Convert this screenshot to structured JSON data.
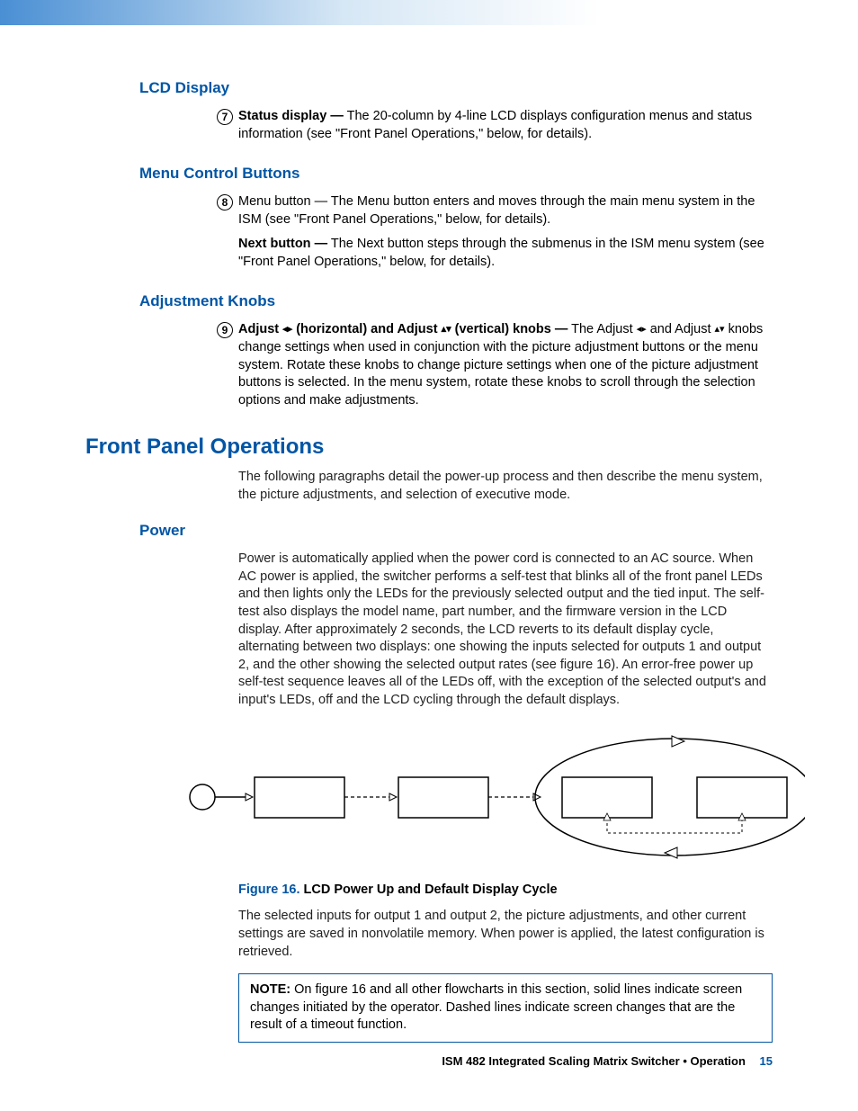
{
  "sections": {
    "lcd": {
      "heading": "LCD Display",
      "item_num": "7",
      "item_lead": "Status display —",
      "item_text": " The 20-column by 4-line LCD displays configuration menus and status information (see \"Front Panel Operations,\" below, for details)."
    },
    "menu": {
      "heading": "Menu Control Buttons",
      "item_num": "8",
      "menu_text": "Menu button — The Menu button enters and moves through the main menu system in the ISM (see \"Front Panel Operations,\" below, for details).",
      "next_lead": "Next button —",
      "next_text": " The Next button steps through the submenus in the ISM menu system (see \"Front Panel Operations,\" below, for details)."
    },
    "adjust": {
      "heading": "Adjustment Knobs",
      "item_num": "9",
      "lead1": "Adjust ",
      "lead2": " (horizontal) and Adjust ",
      "lead3": " (vertical) knobs —",
      "tail1": " The Adjust ",
      "tail2": " and Adjust ",
      "tail3": " knobs change settings when used in conjunction with the picture adjustment buttons or the menu system.  Rotate these knobs to change picture settings when one of the picture adjustment buttons is selected.  In the menu system, rotate these knobs to scroll through the selection options and make adjustments."
    },
    "front_panel": {
      "heading": "Front Panel Operations",
      "intro": "The following paragraphs detail the power-up process and then describe the menu system, the picture adjustments, and selection of executive mode."
    },
    "power": {
      "heading": "Power",
      "p1": "Power is automatically applied when the power cord is connected to an AC source.  When AC power is applied, the switcher performs a self-test that blinks all of the front panel LEDs and then lights only the LEDs for the previously selected output and the tied input.  The self-test also displays the model name, part number, and the firmware version in the LCD display.  After approximately 2 seconds, the LCD reverts to its default display cycle, alternating between two displays: one showing the inputs selected for outputs 1 and output 2, and the other showing the selected output rates (see figure 16).  An error-free power up self-test sequence leaves all of the LEDs off, with the exception of the selected output's and input's LEDs, off and the LCD cycling through the default displays.",
      "fig_label": "Figure 16.",
      "fig_title": "  LCD Power Up and Default Display Cycle",
      "p2": "The selected inputs for output 1 and output 2, the picture adjustments, and other current settings are saved in nonvolatile memory.  When power is applied, the latest configuration is retrieved.",
      "note_label": "NOTE:",
      "note_text": "   On figure 16 and all other flowcharts in this section, solid lines indicate screen changes initiated by the operator.  Dashed lines indicate screen changes that are the result of a timeout function."
    }
  },
  "footer": {
    "text": "ISM 482 Integrated Scaling Matrix Switcher • Operation",
    "page": "15"
  }
}
